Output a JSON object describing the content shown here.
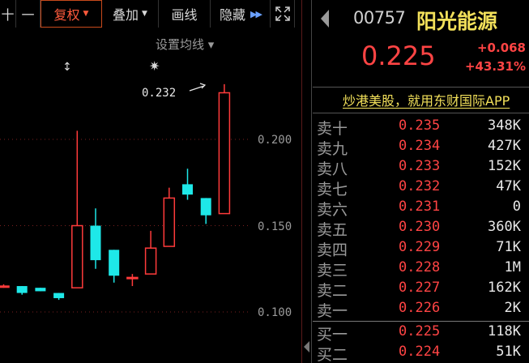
{
  "toolbar": {
    "items": [
      {
        "label": "十",
        "active": false
      },
      {
        "label": "一",
        "active": false
      },
      {
        "label": "复权",
        "active": true
      },
      {
        "label": "叠加",
        "active": false
      },
      {
        "label": "画线",
        "active": false
      },
      {
        "label": "隐藏",
        "active": false
      },
      {
        "label": "",
        "active": false
      }
    ]
  },
  "chart": {
    "set_ma_label": "设置均线 ▾",
    "max_label": "0.232",
    "y_ticks": [
      "0.200",
      "0.150",
      "0.100"
    ],
    "colors": {
      "up": "#ff3b3b",
      "down": "#1ee8e8",
      "grid": "#7a2020",
      "axis_text": "#9a9a9a"
    }
  },
  "chart_data": {
    "type": "candlestick",
    "ylim": [
      0.08,
      0.25
    ],
    "y_ticks": [
      0.2,
      0.15,
      0.1
    ],
    "candles": [
      {
        "open": 0.115,
        "close": 0.115,
        "high": 0.116,
        "low": 0.114
      },
      {
        "open": 0.115,
        "close": 0.111,
        "high": 0.115,
        "low": 0.11
      },
      {
        "open": 0.114,
        "close": 0.112,
        "high": 0.114,
        "low": 0.112
      },
      {
        "open": 0.111,
        "close": 0.108,
        "high": 0.111,
        "low": 0.107
      },
      {
        "open": 0.114,
        "close": 0.15,
        "high": 0.205,
        "low": 0.114
      },
      {
        "open": 0.15,
        "close": 0.13,
        "high": 0.16,
        "low": 0.125
      },
      {
        "open": 0.136,
        "close": 0.121,
        "high": 0.136,
        "low": 0.117
      },
      {
        "open": 0.12,
        "close": 0.12,
        "high": 0.122,
        "low": 0.115
      },
      {
        "open": 0.122,
        "close": 0.137,
        "high": 0.147,
        "low": 0.122
      },
      {
        "open": 0.138,
        "close": 0.166,
        "high": 0.172,
        "low": 0.138
      },
      {
        "open": 0.174,
        "close": 0.168,
        "high": 0.183,
        "low": 0.165
      },
      {
        "open": 0.166,
        "close": 0.156,
        "high": 0.166,
        "low": 0.151
      },
      {
        "open": 0.157,
        "close": 0.227,
        "high": 0.232,
        "low": 0.157
      }
    ]
  },
  "quote": {
    "code": "00757",
    "name": "阳光能源",
    "price": "0.225",
    "change": "+0.068",
    "change_pct": "+43.31%",
    "colors": {
      "up": "#ff4444",
      "name": "#f2e05a"
    }
  },
  "ad_text": "炒港美股，就用东财国际APP",
  "order_book": [
    {
      "label": "卖十",
      "price": "0.235",
      "volume": "348K"
    },
    {
      "label": "卖九",
      "price": "0.234",
      "volume": "427K"
    },
    {
      "label": "卖八",
      "price": "0.233",
      "volume": "152K"
    },
    {
      "label": "卖七",
      "price": "0.232",
      "volume": "47K"
    },
    {
      "label": "卖六",
      "price": "0.231",
      "volume": "0"
    },
    {
      "label": "卖五",
      "price": "0.230",
      "volume": "360K"
    },
    {
      "label": "卖四",
      "price": "0.229",
      "volume": "71K"
    },
    {
      "label": "卖三",
      "price": "0.228",
      "volume": "1M"
    },
    {
      "label": "卖二",
      "price": "0.227",
      "volume": "162K"
    },
    {
      "label": "卖一",
      "price": "0.226",
      "volume": "2K"
    },
    {
      "label": "买一",
      "price": "0.225",
      "volume": "118K"
    },
    {
      "label": "买二",
      "price": "0.224",
      "volume": "51K"
    }
  ]
}
